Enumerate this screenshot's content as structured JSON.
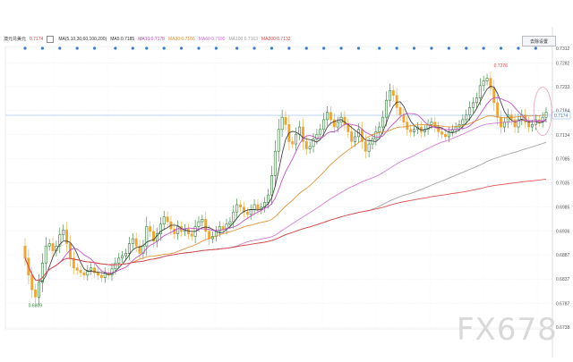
{
  "legend": {
    "symbol": "澳元兑美元",
    "symbol_value": "0.7174",
    "ma_params": "MA(5,10,30,60,100,200)",
    "items": [
      {
        "label": "MA5:0.7185",
        "color": "#333333"
      },
      {
        "label": "MA10:0.7178",
        "color": "#c040c0"
      },
      {
        "label": "MA30:0.7166",
        "color": "#e08a2a"
      },
      {
        "label": "MA60:0.7190",
        "color": "#d070d0"
      },
      {
        "label": "MA100:0.7163",
        "color": "#9a9a9a"
      },
      {
        "label": "MA200:0.7132",
        "color": "#e04040"
      }
    ]
  },
  "toolbar": {
    "button_label": "去除设置"
  },
  "watermark": "FX678",
  "chart_data": {
    "type": "candlestick",
    "y_ticks": [
      "0.7312",
      "0.7282",
      "0.7233",
      "0.7184",
      "0.7134",
      "0.7085",
      "0.7035",
      "0.6985",
      "0.6936",
      "0.6887",
      "0.6837",
      "0.6787",
      "0.6738"
    ],
    "ylim": [
      0.6738,
      0.7312
    ],
    "last_price_label": "0.7174",
    "annotations": [
      {
        "text": "0.7276",
        "x": 136,
        "y": 0.727
      },
      {
        "text": "0.6809",
        "x": 2,
        "y": 0.679
      }
    ],
    "n_candles": 151,
    "closes": [
      0.688,
      0.6845,
      0.6815,
      0.68,
      0.683,
      0.687,
      0.6905,
      0.691,
      0.6895,
      0.6905,
      0.6928,
      0.6938,
      0.691,
      0.688,
      0.686,
      0.6855,
      0.685,
      0.6845,
      0.6855,
      0.686,
      0.685,
      0.6845,
      0.684,
      0.685,
      0.6845,
      0.6858,
      0.687,
      0.688,
      0.6885,
      0.689,
      0.691,
      0.692,
      0.6905,
      0.689,
      0.6905,
      0.6945,
      0.6935,
      0.6915,
      0.693,
      0.695,
      0.6965,
      0.6955,
      0.694,
      0.693,
      0.6945,
      0.6935,
      0.694,
      0.693,
      0.6925,
      0.6945,
      0.6955,
      0.696,
      0.6935,
      0.692,
      0.6925,
      0.6935,
      0.6945,
      0.694,
      0.695,
      0.6955,
      0.6975,
      0.699,
      0.6985,
      0.6975,
      0.697,
      0.698,
      0.699,
      0.698,
      0.6985,
      0.6995,
      0.701,
      0.705,
      0.71,
      0.7145,
      0.717,
      0.7155,
      0.712,
      0.7115,
      0.7135,
      0.715,
      0.712,
      0.7105,
      0.711,
      0.7125,
      0.7135,
      0.7145,
      0.7165,
      0.718,
      0.7165,
      0.715,
      0.716,
      0.717,
      0.7155,
      0.714,
      0.712,
      0.713,
      0.7145,
      0.712,
      0.71,
      0.7115,
      0.7125,
      0.714,
      0.715,
      0.717,
      0.7205,
      0.7225,
      0.7215,
      0.719,
      0.7175,
      0.716,
      0.7145,
      0.714,
      0.7145,
      0.715,
      0.714,
      0.7145,
      0.7155,
      0.716,
      0.715,
      0.714,
      0.7135,
      0.713,
      0.714,
      0.7145,
      0.715,
      0.7155,
      0.7165,
      0.7175,
      0.719,
      0.72,
      0.721,
      0.7235,
      0.7245,
      0.725,
      0.723,
      0.72,
      0.717,
      0.715,
      0.716,
      0.7175,
      0.7165,
      0.715,
      0.7165,
      0.7175,
      0.716,
      0.715,
      0.7155,
      0.7165,
      0.716,
      0.717,
      0.718
    ],
    "series": [
      {
        "name": "MA5",
        "color": "#333333"
      },
      {
        "name": "MA10",
        "color": "#c040c0"
      },
      {
        "name": "MA30",
        "color": "#e08a2a"
      },
      {
        "name": "MA60",
        "color": "#d070d0"
      },
      {
        "name": "MA100",
        "color": "#9a9a9a"
      },
      {
        "name": "MA200",
        "color": "#e04040"
      }
    ],
    "up_color": "#2e7d32",
    "down_color": "#e9a63a",
    "grid": true,
    "dot_marker_color": "#3a7dc8",
    "dot_marker_indices": [
      0,
      5,
      10,
      15,
      20,
      26,
      31,
      35,
      40,
      45,
      50,
      55,
      61,
      66,
      71,
      76,
      81,
      86,
      91,
      96,
      102,
      107,
      112,
      117,
      122,
      127,
      132,
      137,
      142,
      147
    ]
  }
}
